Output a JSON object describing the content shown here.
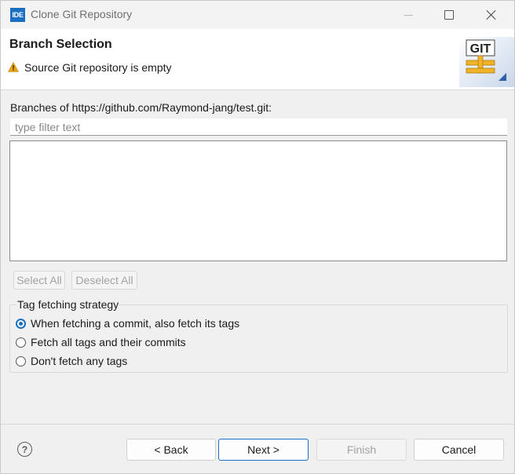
{
  "window": {
    "app_icon_label": "IDE",
    "title": "Clone Git Repository"
  },
  "banner": {
    "title": "Branch Selection",
    "message": "Source Git repository is empty",
    "logo_text": "GIT"
  },
  "branches": {
    "label": "Branches of https://github.com/Raymond-jang/test.git:",
    "filter_placeholder": "type filter text",
    "filter_value": "",
    "items": []
  },
  "selection_buttons": {
    "select_all": "Select All",
    "deselect_all": "Deselect All"
  },
  "tag_strategy": {
    "legend": "Tag fetching strategy",
    "options": [
      {
        "label": "When fetching a commit, also fetch its tags",
        "selected": true
      },
      {
        "label": "Fetch all tags and their commits",
        "selected": false
      },
      {
        "label": "Don't fetch any tags",
        "selected": false
      }
    ]
  },
  "footer": {
    "help_glyph": "?",
    "back": "< Back",
    "next": "Next >",
    "finish": "Finish",
    "cancel": "Cancel"
  },
  "colors": {
    "accent": "#1b6fc2",
    "warning": "#e8a317"
  }
}
